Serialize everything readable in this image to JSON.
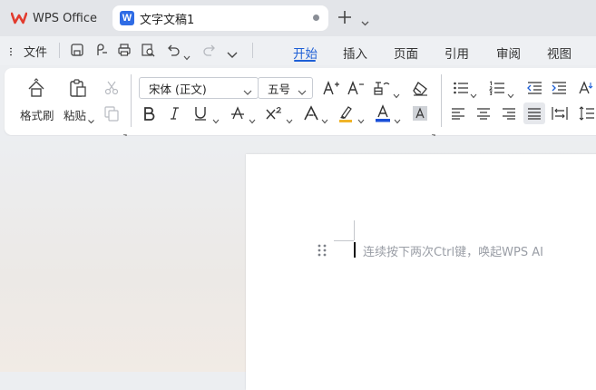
{
  "tabs": {
    "app_label": "WPS Office",
    "doc_title": "文字文稿1"
  },
  "menu": {
    "file_label": "文件",
    "tabs": [
      {
        "label": "开始"
      },
      {
        "label": "插入"
      },
      {
        "label": "页面"
      },
      {
        "label": "引用"
      },
      {
        "label": "审阅"
      },
      {
        "label": "视图"
      }
    ],
    "active_tab": "开始"
  },
  "ribbon": {
    "format_painter_label": "格式刷",
    "paste_label": "粘贴",
    "font_name": "宋体 (正文)",
    "font_size": "五号"
  },
  "document": {
    "placeholder_hint": "连续按下两次Ctrl键，唤起WPS AI"
  },
  "colors": {
    "accent": "#1e5fd6",
    "wps_red": "#e23b2e",
    "doc_blue": "#2f6ce5",
    "font_color_bar": "#1a4fd8",
    "highlight_bar": "#f0b429"
  }
}
